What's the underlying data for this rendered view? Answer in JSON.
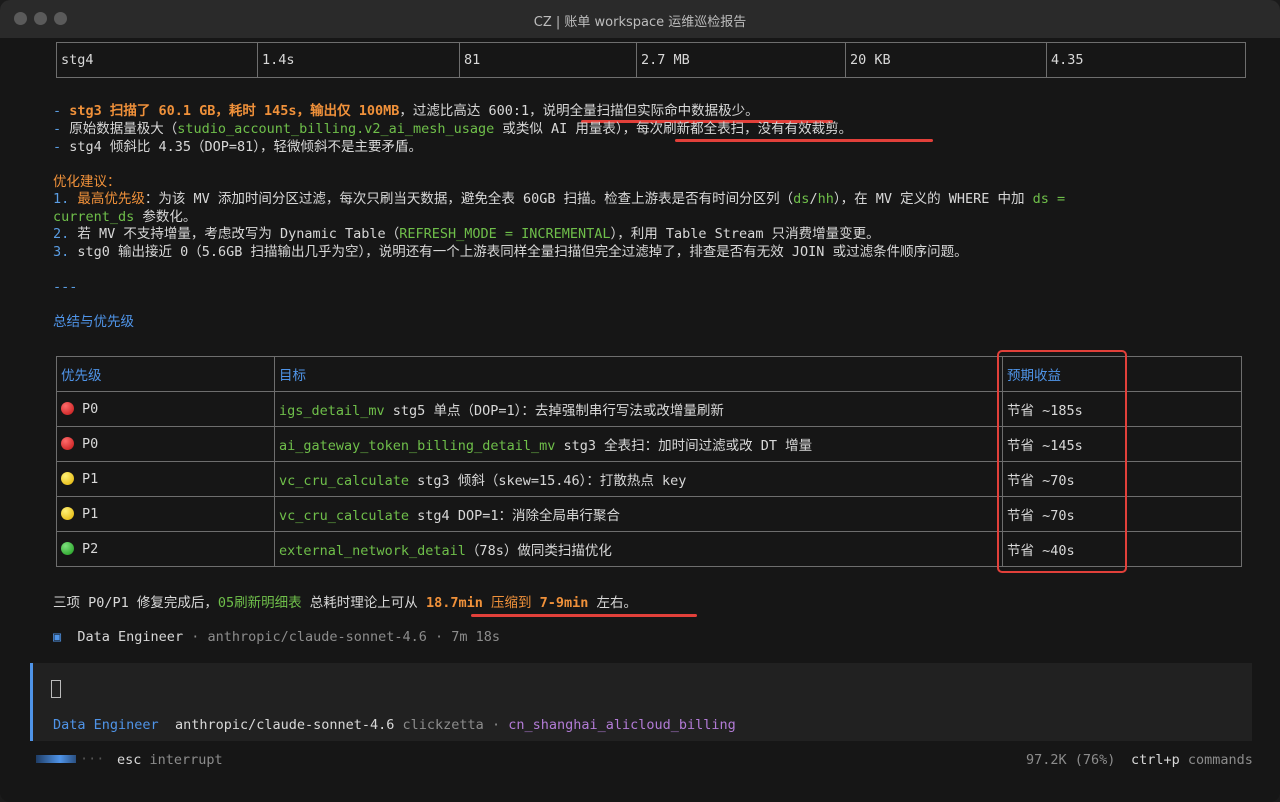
{
  "window": {
    "title": "CZ | 账单 workspace 运维巡检报告"
  },
  "top_table": {
    "row": [
      "stg4",
      "1.4s",
      "81",
      "2.7 MB",
      "20 KB",
      "4.35"
    ]
  },
  "analysis": {
    "b1_dash": "- ",
    "b1_hl": "stg3 扫描了 60.1 GB，耗时 145s，输出仅 100MB",
    "b1_mid": "，过滤比高达 600:1，",
    "b1_ul": "说明全量扫描但实际命中数据极少。",
    "b2_dash": "- ",
    "b2_a": "原始数据量极大（",
    "b2_code": "studio_account_billing.v2_ai_mesh_usage",
    "b2_b": " 或类似 AI 用量表），",
    "b2_ul": "每次刷新都全表扫，没有有效裁剪。",
    "b3_dash": "- ",
    "b3": "stg4 倾斜比 4.35（DOP=81），轻微倾斜不是主要矛盾。"
  },
  "suggestions": {
    "heading": "优化建议：",
    "s1_num": "1. ",
    "s1_hl": "最高优先级",
    "s1_a": "：为该 MV 添加时间分区过滤，每次只刷当天数据，避免全表 60GB 扫描。检查上游表是否有时间分区列（",
    "s1_code1": "ds",
    "s1_slash": "/",
    "s1_code2": "hh",
    "s1_b": "），在 MV 定义的 WHERE 中加 ",
    "s1_code3": "ds =",
    "s1_code4": "current_ds",
    "s1_c": " 参数化。",
    "s2_num": "2. ",
    "s2_a": "若 MV 不支持增量，考虑改写为 Dynamic Table（",
    "s2_code": "REFRESH_MODE = INCREMENTAL",
    "s2_b": "），利用 Table Stream 只消费增量变更。",
    "s3_num": "3. ",
    "s3": "stg0 输出接近 0（5.6GB 扫描输出几乎为空），说明还有一个上游表同样全量扫描但完全过滤掉了，排查是否有无效 JOIN 或过滤条件顺序问题。"
  },
  "separator": "---",
  "summary": {
    "heading": "总结与优先级",
    "headers": [
      "优先级",
      "目标",
      "预期收益"
    ],
    "rows": [
      {
        "priority": "P0",
        "code": "igs_detail_mv",
        "desc": " stg5 单点（DOP=1）：去掉强制串行写法或改增量刷新",
        "gain": "节省 ~185s"
      },
      {
        "priority": "P0",
        "code": "ai_gateway_token_billing_detail_mv",
        "desc": " stg3 全表扫：加时间过滤或改 DT 增量",
        "gain": "节省 ~145s"
      },
      {
        "priority": "P1",
        "code": "vc_cru_calculate",
        "desc": " stg3 倾斜（skew=15.46）：打散热点 key",
        "gain": "节省 ~70s"
      },
      {
        "priority": "P1",
        "code": "vc_cru_calculate",
        "desc": " stg4 DOP=1：消除全局串行聚合",
        "gain": "节省 ~70s"
      },
      {
        "priority": "P2",
        "code": "external_network_detail",
        "desc": "（78s）做同类扫描优化",
        "gain": "节省 ~40s"
      }
    ]
  },
  "conclusion": {
    "a": "三项 P0/P1 修复完成后，",
    "code": "05刷新明细表",
    "b": " 总耗时理论上可从 ",
    "hl1": "18.7min",
    "mid": " 压缩到 ",
    "hl2": "7-9min",
    "c": " 左右。"
  },
  "agent_line": {
    "icon": "▣",
    "agent": "Data Engineer",
    "model": " · anthropic/claude-sonnet-4.6 · 7m 18s"
  },
  "prompt": {
    "agent": "Data Engineer",
    "model": "anthropic/claude-sonnet-4.6",
    "provider": "clickzetta",
    "sep": " · ",
    "workspace": "cn_shanghai_alicloud_billing"
  },
  "status": {
    "esc_key": "esc",
    "esc_label": " interrupt",
    "tokens": "97.2K (76%)",
    "cmd_key": "ctrl+p",
    "cmd_label": " commands"
  },
  "colors": {
    "accent": "#4f94e8",
    "highlight": "#f0913a",
    "code": "#6fbf4a",
    "annotation": "#e2403a",
    "workspace": "#b27bd6"
  }
}
